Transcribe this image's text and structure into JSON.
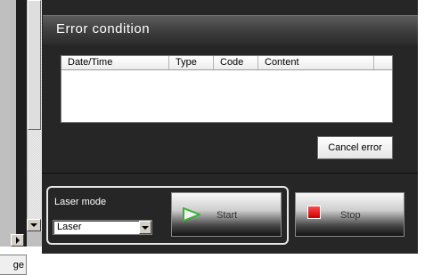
{
  "left_panel": {
    "page_tab_label": "ge"
  },
  "error_section": {
    "title": "Error condition",
    "table_columns": [
      "Date/Time",
      "Type",
      "Code",
      "Content"
    ],
    "rows": [],
    "cancel_button_label": "Cancel error"
  },
  "laser_controls": {
    "mode_label": "Laser mode",
    "mode_value": "Laser",
    "start_button_label": "Start",
    "stop_button_label": "Stop",
    "start_icon": "play-icon",
    "stop_icon": "stop-square-icon"
  },
  "colors": {
    "panel_background": "#262626",
    "start_icon": "#32b432",
    "stop_icon": "#e00000"
  }
}
